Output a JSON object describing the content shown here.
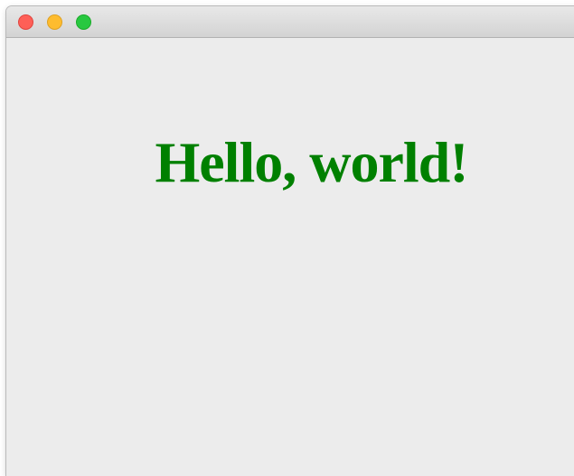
{
  "window": {
    "controls": {
      "close_color": "#fe5f57",
      "minimize_color": "#febc2e",
      "maximize_color": "#28c840"
    }
  },
  "content": {
    "heading": "Hello, world!",
    "heading_color": "#008000"
  }
}
